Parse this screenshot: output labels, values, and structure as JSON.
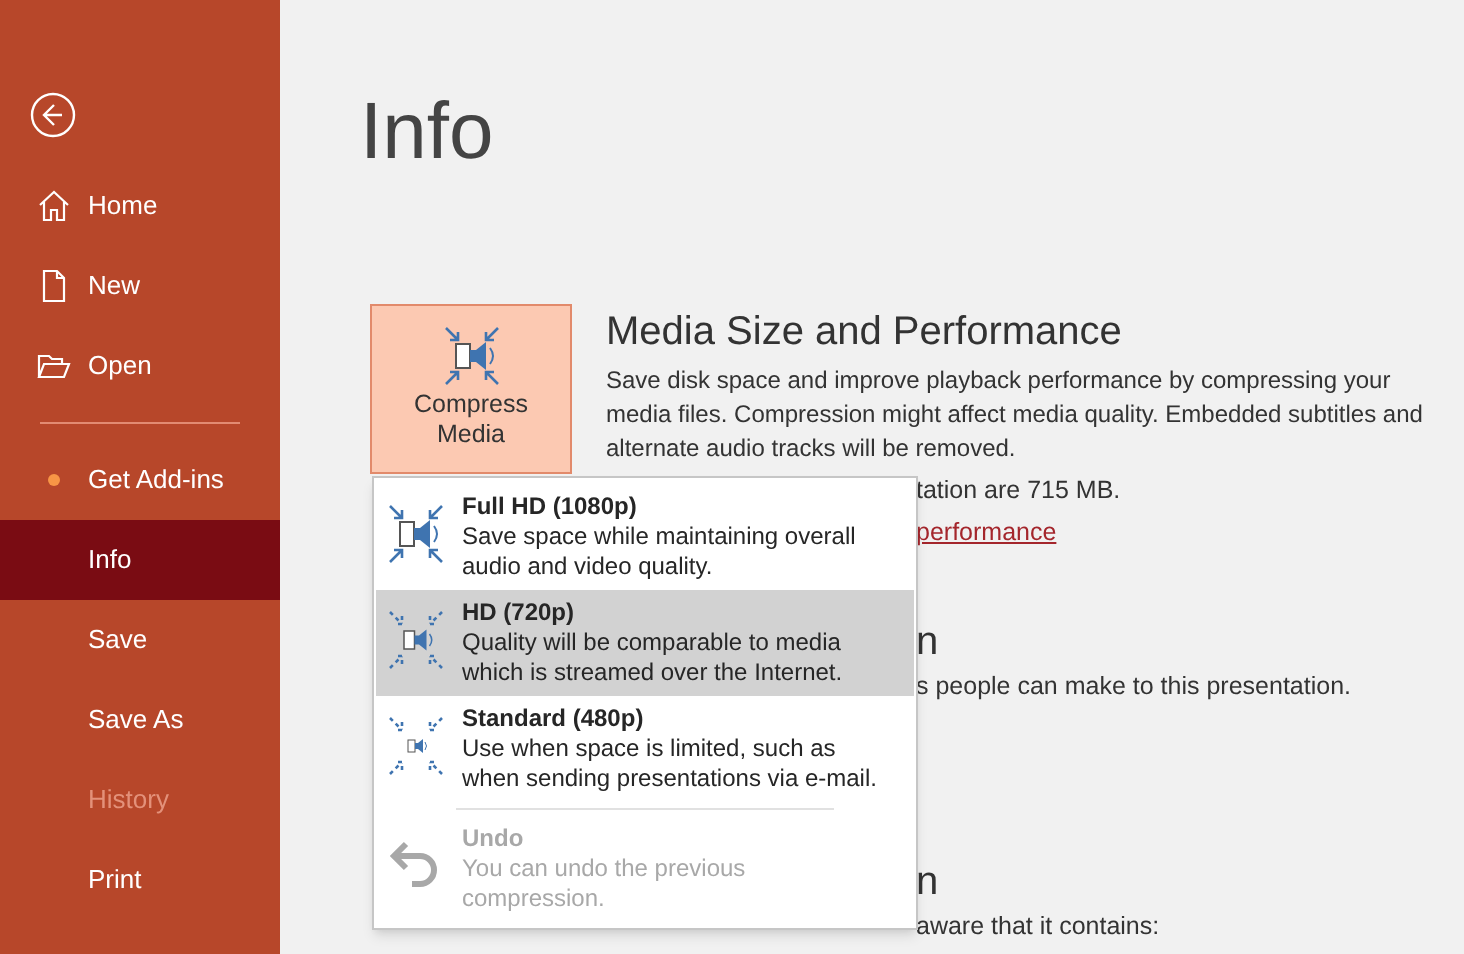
{
  "sidebar": {
    "items": [
      {
        "label": "Home",
        "kind": "home",
        "selected": false,
        "disabled": false
      },
      {
        "label": "New",
        "kind": "new",
        "selected": false,
        "disabled": false
      },
      {
        "label": "Open",
        "kind": "open",
        "selected": false,
        "disabled": false,
        "divider_after": true
      },
      {
        "label": "Get Add-ins",
        "kind": "dot",
        "selected": false,
        "disabled": false
      },
      {
        "label": "Info",
        "kind": "plain",
        "selected": true,
        "disabled": false
      },
      {
        "label": "Save",
        "kind": "plain",
        "selected": false,
        "disabled": false
      },
      {
        "label": "Save As",
        "kind": "plain",
        "selected": false,
        "disabled": false
      },
      {
        "label": "History",
        "kind": "plain",
        "selected": false,
        "disabled": true
      },
      {
        "label": "Print",
        "kind": "plain",
        "selected": false,
        "disabled": false
      }
    ]
  },
  "page_title": "Info",
  "compress_button": {
    "label": "Compress Media"
  },
  "media_section": {
    "heading": "Media Size and Performance",
    "description": "Save disk space and improve playback performance by compressing your media files. Compression might affect media quality. Embedded subtitles and alternate audio tracks will be removed.",
    "fragments": [
      {
        "kind": "text",
        "text": "tation are 715 MB."
      },
      {
        "kind": "link",
        "text": "performance"
      },
      {
        "kind": "heading",
        "text": "n"
      },
      {
        "kind": "text",
        "text": "s people can make to this presentation."
      },
      {
        "kind": "heading",
        "text": "n"
      },
      {
        "kind": "text",
        "text": "aware that it contains:"
      }
    ]
  },
  "compress_menu": [
    {
      "kind": "full",
      "title": "Full HD (1080p)",
      "description": "Save space while maintaining overall audio and video quality.",
      "selected": false,
      "disabled": false
    },
    {
      "kind": "hd",
      "title": "HD (720p)",
      "description": "Quality will be comparable to media which is streamed over the Internet.",
      "selected": true,
      "disabled": false
    },
    {
      "kind": "standard",
      "title": "Standard (480p)",
      "description": "Use when space is limited, such as when sending presentations via e-mail.",
      "selected": false,
      "disabled": false
    },
    {
      "kind": "undo",
      "title": "Undo",
      "description": "You can undo the previous compression.",
      "selected": false,
      "disabled": true,
      "separator_before": true
    }
  ]
}
